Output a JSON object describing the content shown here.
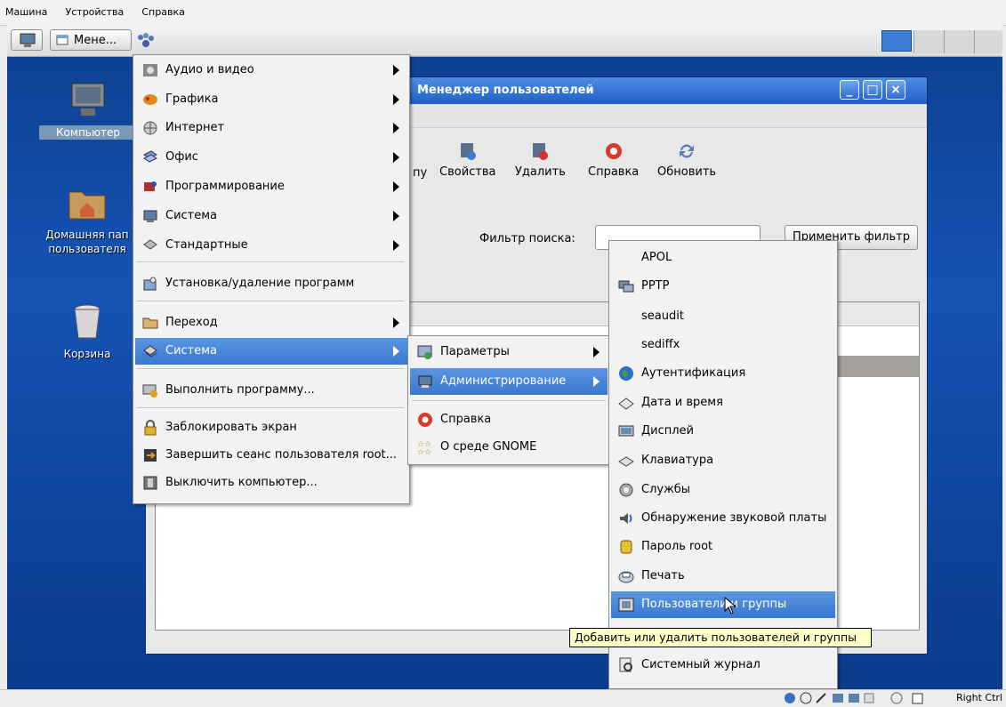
{
  "host_menubar": [
    "Машина",
    "Устройства",
    "Справка"
  ],
  "panel": {
    "menu_button": "Мене...",
    "colors": {
      "panel_bg": "#e4e4e4",
      "desktop": "#1554b5"
    }
  },
  "desktop_icons": [
    {
      "name": "computer-icon",
      "label": "Компьютер"
    },
    {
      "name": "home-folder-icon",
      "label1": "Домашняя пап",
      "label2": "пользователя"
    },
    {
      "name": "trash-icon",
      "label": "Корзина"
    }
  ],
  "user_manager": {
    "title": "Менеджер пользователей",
    "toolbar": [
      "пу",
      "Свойства",
      "Удалить",
      "Справка",
      "Обновить"
    ],
    "filter_label": "Фильтр поиска:",
    "filter_value": "",
    "apply_label": "Применить фильтр"
  },
  "main_menu": {
    "items": [
      "Аудио и видео",
      "Графика",
      "Интернет",
      "Офис",
      "Программирование",
      "Система",
      "Стандартные",
      "Установка/удаление программ",
      "Переход",
      "Система",
      "Выполнить программу...",
      "Заблокировать экран",
      "Завершить сеанс пользователя root...",
      "Выключить компьютер..."
    ]
  },
  "system_menu": {
    "items": [
      "Параметры",
      "Администрирование",
      "Справка",
      "О среде GNOME"
    ]
  },
  "admin_menu": {
    "items": [
      "APOL",
      "PPTP",
      "seaudit",
      "sediffx",
      "Аутентификация",
      "Дата и время",
      "Дисплей",
      "Клавиатура",
      "Службы",
      "Обнаружение звуковой платы",
      "Пароль root",
      "Печать",
      "Пользователи и группы",
      "Системный журнал"
    ]
  },
  "tooltip": "Добавить или удалить пользователей и группы",
  "status_bar": {
    "host_key": "Right Ctrl"
  }
}
